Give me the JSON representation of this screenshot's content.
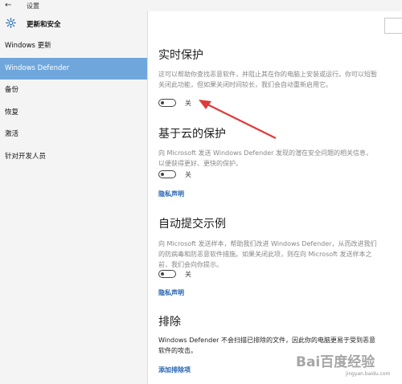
{
  "window": {
    "title": "设置"
  },
  "header": {
    "title": "更新和安全"
  },
  "sidebar": {
    "items": [
      {
        "label": "Windows 更新",
        "active": false
      },
      {
        "label": "Windows Defender",
        "active": true
      },
      {
        "label": "备份",
        "active": false
      },
      {
        "label": "恢复",
        "active": false
      },
      {
        "label": "激活",
        "active": false
      },
      {
        "label": "针对开发人员",
        "active": false
      }
    ]
  },
  "sections": {
    "realtime": {
      "title": "实时保护",
      "desc": "这可以帮助你查找恶意软件，并阻止其在你的电脑上安装或运行。你可以短暂关闭此功能，但如果关闭时间较长，我们会自动重新启用它。",
      "toggle_label": "关"
    },
    "cloud": {
      "title": "基于云的保护",
      "desc": "向 Microsoft 发送 Windows Defender 发现的潜在安全问题的相关信息，以便获得更好、更快的保护。",
      "toggle_label": "关",
      "link": "隐私声明"
    },
    "sample": {
      "title": "自动提交示例",
      "desc": "向 Microsoft 发送样本，帮助我们改进 Windows Defender，从而改进我们的防病毒和防恶意软件措施。如果关闭此项，则在向 Microsoft 发送样本之前，我们会向你提示。",
      "toggle_label": "关",
      "link": "隐私声明"
    },
    "exclusions": {
      "title": "排除",
      "desc": "Windows Defender 不会扫描已排除的文件，因此你的电脑更易于受到恶意软件的攻击。",
      "link": "添加排除项"
    }
  },
  "watermark": {
    "brand": "Bai百度经验",
    "sub": "jingyan.baidu.com"
  },
  "colors": {
    "accent": "#6fa7dc",
    "link": "#2563b0",
    "arrow": "#e03a3a"
  }
}
